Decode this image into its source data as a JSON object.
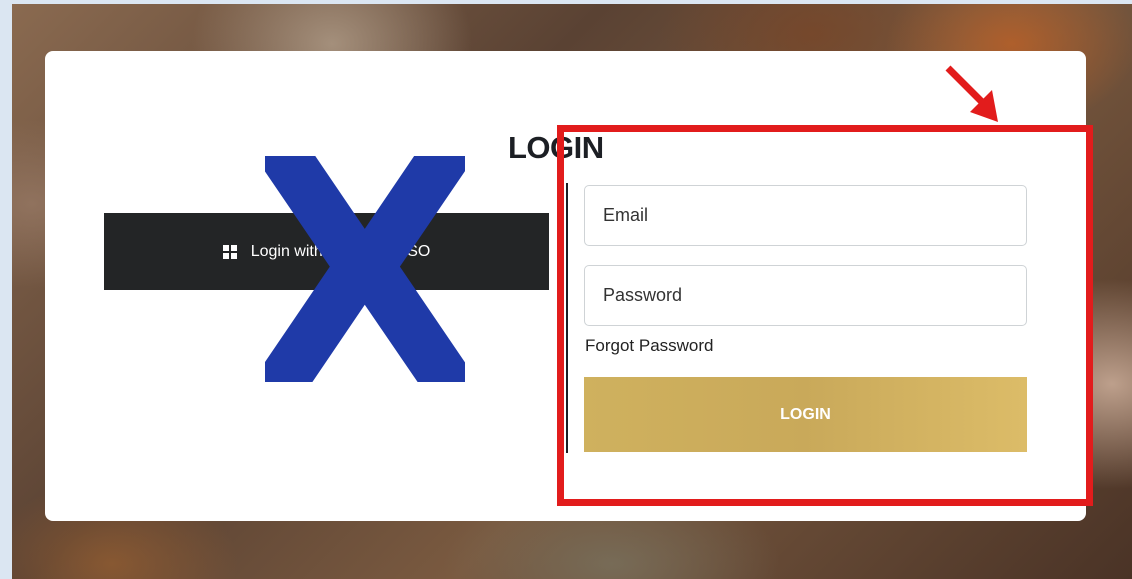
{
  "login_form": {
    "title": "LOGIN",
    "sso_button_label": "Login with Microsoft SSO",
    "email_placeholder": "Email",
    "password_placeholder": "Password",
    "forgot_password_label": "Forgot Password",
    "login_button_label": "LOGIN"
  },
  "annotations": {
    "cross_mark": "X",
    "highlight_color": "#e21c1c",
    "cross_color": "#1f3aa8"
  },
  "icons": {
    "sso": "windows-icon",
    "pointer": "arrow-icon"
  },
  "colors": {
    "login_button": "#cfb15e",
    "sso_button": "#232526"
  }
}
